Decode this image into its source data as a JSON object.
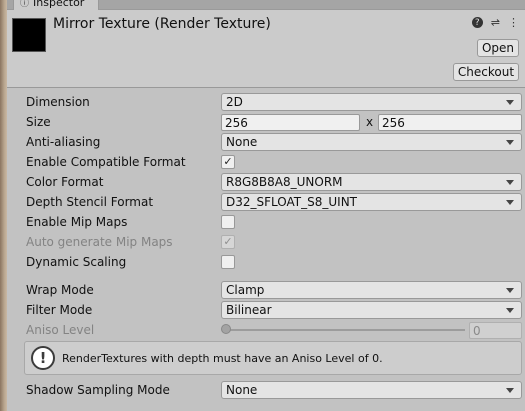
{
  "tab": {
    "title": "Inspector"
  },
  "header": {
    "asset_title": "Mirror Texture (Render Texture)",
    "open_label": "Open",
    "checkout_label": "Checkout"
  },
  "props": {
    "dimension": {
      "label": "Dimension",
      "value": "2D"
    },
    "size": {
      "label": "Size",
      "width": "256",
      "sep": "x",
      "height": "256"
    },
    "anti_aliasing": {
      "label": "Anti-aliasing",
      "value": "None"
    },
    "enable_compatible_format": {
      "label": "Enable Compatible Format",
      "checked": true,
      "mark": "✓"
    },
    "color_format": {
      "label": "Color Format",
      "value": "R8G8B8A8_UNORM"
    },
    "depth_stencil_format": {
      "label": "Depth Stencil Format",
      "value": "D32_SFLOAT_S8_UINT"
    },
    "enable_mip_maps": {
      "label": "Enable Mip Maps",
      "checked": false
    },
    "auto_generate_mip_maps": {
      "label": "Auto generate Mip Maps",
      "checked": true,
      "disabled": true,
      "mark": "✓"
    },
    "dynamic_scaling": {
      "label": "Dynamic Scaling",
      "checked": false
    },
    "wrap_mode": {
      "label": "Wrap Mode",
      "value": "Clamp"
    },
    "filter_mode": {
      "label": "Filter Mode",
      "value": "Bilinear"
    },
    "aniso_level": {
      "label": "Aniso Level",
      "value": "0",
      "disabled": true
    },
    "shadow_sampling_mode": {
      "label": "Shadow Sampling Mode",
      "value": "None"
    }
  },
  "helpbox": {
    "message": "RenderTextures with depth must have an Aniso Level of 0."
  }
}
